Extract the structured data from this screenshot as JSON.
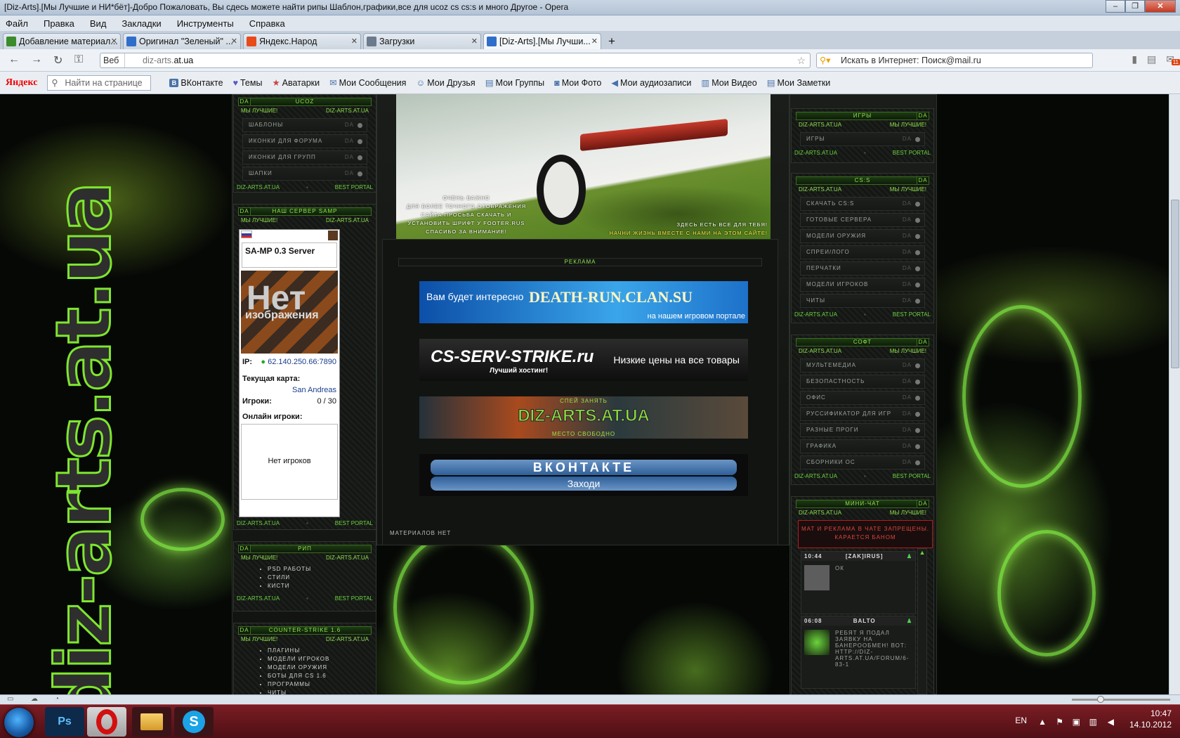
{
  "window": {
    "title": "[Diz-Arts].[Мы Лучшие и НИ*бёт]-Добро Пожаловать, Вы сдесь можете найти рипы Шаблон,графики,все для ucoz cs cs:s и много Другое - Opera",
    "min": "‒",
    "max": "❐",
    "close": "✕"
  },
  "menu": [
    "Файл",
    "Правка",
    "Вид",
    "Закладки",
    "Инструменты",
    "Справка"
  ],
  "tabs": [
    {
      "label": "Добавление материал...",
      "fav": "#3a8d2a"
    },
    {
      "label": "Оригинал \"Зеленый\" ...",
      "fav": "#2f6fc9"
    },
    {
      "label": "Яндекс.Народ",
      "fav": "#e94a1a"
    },
    {
      "label": "Загрузки",
      "fav": "#6b7a8c"
    },
    {
      "label": "[Diz-Arts].[Мы Лучши...",
      "fav": "#2f6fc9"
    }
  ],
  "address": {
    "web_label": "Веб",
    "url_prefix": "diz-arts.",
    "url_domain": "at.ua",
    "search_placeholder": "Искать в Интернет: Поиск@mail.ru",
    "mail_badge": "11"
  },
  "bookmarks": {
    "brand": "Яндекс",
    "find_placeholder": "Найти на странице",
    "items": [
      "ВКонтакте",
      "Темы",
      "Аватарки",
      "Мои Сообщения",
      "Мои Друзья",
      "Мои Группы",
      "Мои Фото",
      "Мои аудиозаписи",
      "Мои Видео",
      "Мои Заметки"
    ]
  },
  "site": {
    "bg_logo": "diz-arts.at.ua",
    "footer_left": "DIZ-ARTS.AT.UA",
    "footer_right": "BEST PORTAL",
    "sub_left": "МЫ ЛУЧШИЕ!",
    "sub_right": "DIZ-ARTS.AT.UA",
    "da": "DA",
    "ucoz": {
      "title": "UCOZ",
      "items": [
        "шаблоны",
        "иконки для форума",
        "иконки для групп",
        "шапки"
      ]
    },
    "samp_block": {
      "title": "НАШ СЕРВЕР SAMP"
    },
    "samp": {
      "server": "SA-MP 0.3 Server",
      "noimg": "Нет",
      "noimg_sub": "изображения",
      "ip_label": "IP:",
      "ip": "62.140.250.66:7890",
      "map_label": "Текущая карта:",
      "map": "San Andreas",
      "players_label": "Игроки:",
      "players": "0 / 30",
      "online_label": "Онлайн игроки:",
      "no_players": "Нет игроков"
    },
    "rip": {
      "title": "РИП",
      "items": [
        "PSD РАБОТЫ",
        "СТИЛИ",
        "КИСТИ"
      ]
    },
    "cs16": {
      "title": "COUNTER-STRIKE 1.6",
      "items": [
        "ПЛАГИНЫ",
        "МОДЕЛИ ИГРОКОВ",
        "МОДЕЛИ ОРУЖИЯ",
        "БОТЫ ДЛЯ CS 1.6",
        "ПРОГРАММЫ",
        "ЧИТЫ"
      ]
    },
    "car": {
      "notice": [
        "ОЧЕНЬ ВАЖНО",
        "ДЛЯ БОЛЕЕ ТОЧНОГО ОТОБРАЖЕНИЯ",
        "САЙТА ПРОСЬБА СКАЧАТЬ И",
        "УСТАНОВИТЬ ШРИФТ У FOOTER.RUS",
        "СПАСИБО ЗА ВНИМАНИЕ!"
      ],
      "slogan1": "ЗДЕСЬ ЕСТЬ ВСЕ ДЛЯ ТЕБЯ!",
      "slogan2": "НАЧНИ ЖИЗНЬ ВМЕСТЕ С НАМИ НА ЭТОМ САЙТЕ!"
    },
    "ads": {
      "title": "РЕКЛАМА",
      "ad1_left": "Вам будет интересно",
      "ad1_brand": "DEATH-RUN.CLAN.SU",
      "ad1_sub": "на нашем игровом портале",
      "ad2_brand": "CS-SERV-STRIKE.ru",
      "ad2_sub": "Лучший хостинг!",
      "ad2_right": "Низкие цены на все товары",
      "ad3_top": "СПЕЙ ЗАНЯТЬ",
      "ad3_brand": "DIZ-ARTS.AT.UA",
      "ad3_bottom": "МЕСТО СВОБОДНО",
      "ad4_brand": "ВКОНТАКТЕ",
      "ad4_sub": "Заходи"
    },
    "no_materials": "МАТЕРИАЛОВ НЕТ",
    "games": {
      "title": "ИГРЫ",
      "items": [
        "ИГРЫ"
      ]
    },
    "css": {
      "title": "CS:S",
      "items": [
        "СКАЧАТЬ CS:S",
        "ГОТОВЫЕ СЕРВЕРА",
        "МОДЕЛИ ОРУЖИЯ",
        "СПРЕИ/ЛОГО",
        "ПЕРЧАТКИ",
        "МОДЕЛИ ИГРОКОВ",
        "ЧИТЫ"
      ]
    },
    "soft": {
      "title": "СОФТ",
      "items": [
        "МУЛЬТЕМЕДИА",
        "БЕЗОПАСТНОСТЬ",
        "ОФИС",
        "РУССИФИКАТОР ДЛЯ ИГР",
        "РАЗНЫЕ ПРОГИ",
        "ГРАФИКА",
        "СБОРНИКИ ОС"
      ]
    },
    "minichat": {
      "title": "МИНИ-ЧАТ",
      "warning": "МАТ И РЕКЛАМА В ЧАТЕ ЗАПРЕЩЕНЫ. КАРАЕТСЯ БАНОМ",
      "messages": [
        {
          "time": "10:44",
          "user": "[ZAK]IRUS]",
          "text": "ОК"
        },
        {
          "time": "06:08",
          "user": "BALTO",
          "text": "РЕБЯТ Я ПОДАЛ ЗАЯВКУ НА БАНЕРООБМЕН! ВОТ: HTTP://DIZ-ARTS.AT.UA/FORUM/6-83-1"
        }
      ]
    }
  },
  "taskbar": {
    "lang": "EN",
    "time": "10:47",
    "date": "14.10.2012",
    "apps": [
      "Ps",
      "Opera",
      "Проводник",
      "Skype"
    ]
  }
}
